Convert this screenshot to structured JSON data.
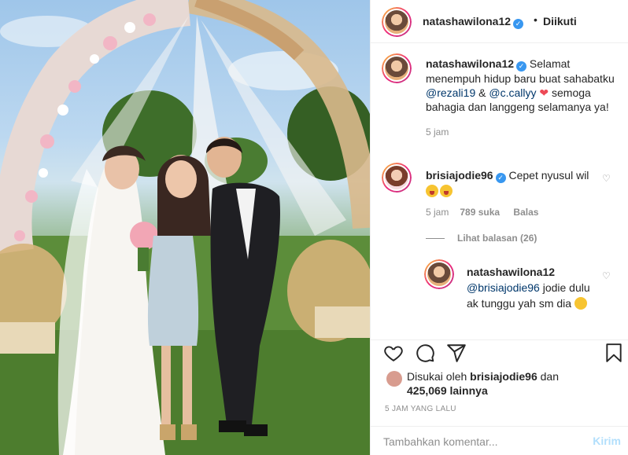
{
  "post": {
    "username": "natashawilona12",
    "follow_status": "Diikuti",
    "caption": {
      "username": "natashawilona12",
      "text_1": " Selamat menempuh hidup baru buat sahabatku ",
      "mention_1": "@rezali19",
      "amp": " & ",
      "mention_2": "@c.callyy",
      "text_2": "semoga bahagia dan langgeng selamanya ya!",
      "age": "5 jam"
    },
    "comments": [
      {
        "username": "brisiajodie96",
        "text": "Cepet nyusul wil",
        "age": "5 jam",
        "likes": "789 suka",
        "reply_label": "Balas",
        "view_replies": "Lihat balasan (26)"
      }
    ],
    "reply": {
      "username": "natashawilona12",
      "mention": "@brisiajodie96",
      "text": " jodie dulu ak tunggu yah sm dia"
    },
    "liked_by": {
      "prefix": "Disukai oleh ",
      "user": "brisiajodie96",
      "suffix": " dan",
      "others": "425,069 lainnya"
    },
    "timestamp": "5 JAM YANG LALU",
    "comment_input": {
      "placeholder": "Tambahkan komentar..."
    },
    "post_button": "Kirim"
  },
  "icons": {
    "verified": "verified-badge-icon",
    "like": "heart-icon",
    "comment": "comment-icon",
    "share": "share-icon",
    "save": "bookmark-icon"
  },
  "colors": {
    "verified": "#3897f0",
    "mention": "#00376b",
    "muted": "#8e8e8e",
    "post_disabled": "#b2dffc"
  }
}
